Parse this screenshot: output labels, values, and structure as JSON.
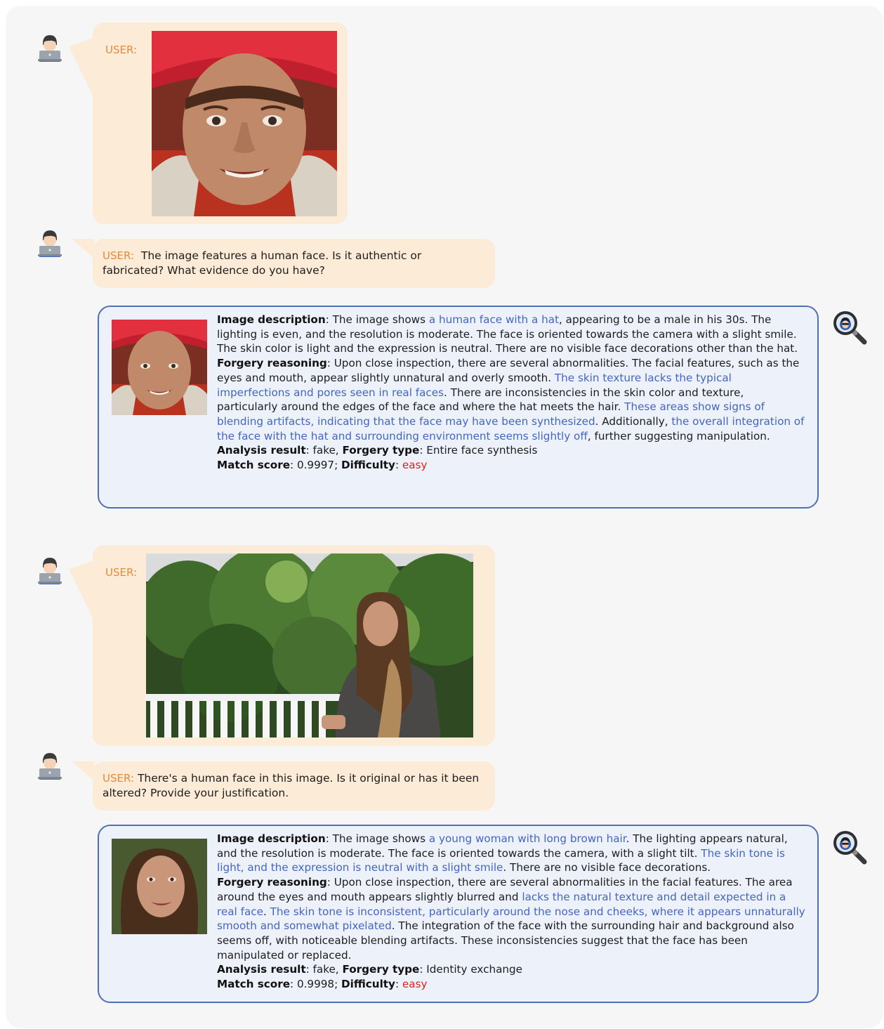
{
  "conversation": [
    {
      "user_label": "USER:",
      "image_caption": "",
      "question": "The image features a human face. Is it authentic or fabricated? What evidence do you have?",
      "answer": {
        "desc_heading": "Image description",
        "desc_p1": ": The image shows ",
        "desc_hl1": "a human face with a hat",
        "desc_p2": ", appearing to be a male in his 30s. The lighting is even, and the resolution is moderate. The face is oriented towards the camera with a slight smile. The skin color is light and the expression is neutral. There are no visible face decorations other than the hat.",
        "reason_heading": "Forgery reasoning",
        "reason_p1": ": Upon close inspection, there are several abnormalities. The facial features, such as the eyes and mouth, appear slightly unnatural and overly smooth. ",
        "reason_hl1": "The skin texture lacks the typical imperfections and pores seen in real faces",
        "reason_p2": ". There are inconsistencies in the skin color and texture, particularly around the edges of the face and where the hat meets the hair. ",
        "reason_hl2": "These areas show signs of blending artifacts, indicating that the face may have been synthesized",
        "reason_p3": ". Additionally, ",
        "reason_hl3": "the overall integration of the face with the hat and surrounding environment seems slightly off",
        "reason_p4": ", further suggesting manipulation.",
        "result_heading": "Analysis result",
        "result_value": ": fake, ",
        "type_heading": "Forgery type",
        "type_value": ": Entire face synthesis",
        "score_heading": "Match score",
        "score_value": ": 0.9997; ",
        "difficulty_heading": "Difficulty",
        "difficulty_sep": ": ",
        "difficulty_value": "easy"
      }
    },
    {
      "user_label": "USER:",
      "question": "There's a human face in this image. Is it original or has it been altered? Provide your justification.",
      "answer": {
        "desc_heading": "Image description",
        "desc_p1": ": The image shows ",
        "desc_hl1": "a young woman with long brown hair",
        "desc_p2": ". The lighting appears natural, and the resolution is moderate. The face is oriented towards the camera, with a slight tilt. ",
        "desc_hl2": "The skin tone is light, and the expression is neutral with a slight smile",
        "desc_p3": ". There are no visible face decorations.",
        "reason_heading": "Forgery reasoning",
        "reason_p1": ": Upon close inspection, there are several abnormalities in the facial features. The area around the eyes and mouth appears slightly blurred and ",
        "reason_hl1": "lacks the natural texture and detail expected in a real face",
        "reason_p2": ". ",
        "reason_hl2": "The skin tone is inconsistent, particularly around the nose and cheeks, where it appears unnaturally smooth and somewhat pixelated",
        "reason_p3": ". The integration of the face with the surrounding hair and background also seems off, with noticeable blending artifacts. These inconsistencies suggest that the face has been manipulated or replaced.",
        "result_heading": "Analysis result",
        "result_value": ": fake, ",
        "type_heading": "Forgery type",
        "type_value": ": Identity exchange",
        "score_heading": "Match score",
        "score_value": ": 0.9998; ",
        "difficulty_heading": "Difficulty",
        "difficulty_sep": ": ",
        "difficulty_value": "easy"
      }
    }
  ],
  "icons": {
    "user": "user-laptop-icon",
    "assistant": "magnifier-detective-icon"
  },
  "colors": {
    "user_bubble": "#fcebd6",
    "user_label": "#e58a3a",
    "answer_bg": "#edf1fa",
    "answer_border": "#4f6fb6",
    "highlight": "#4466c0",
    "difficulty": "#e02020"
  }
}
